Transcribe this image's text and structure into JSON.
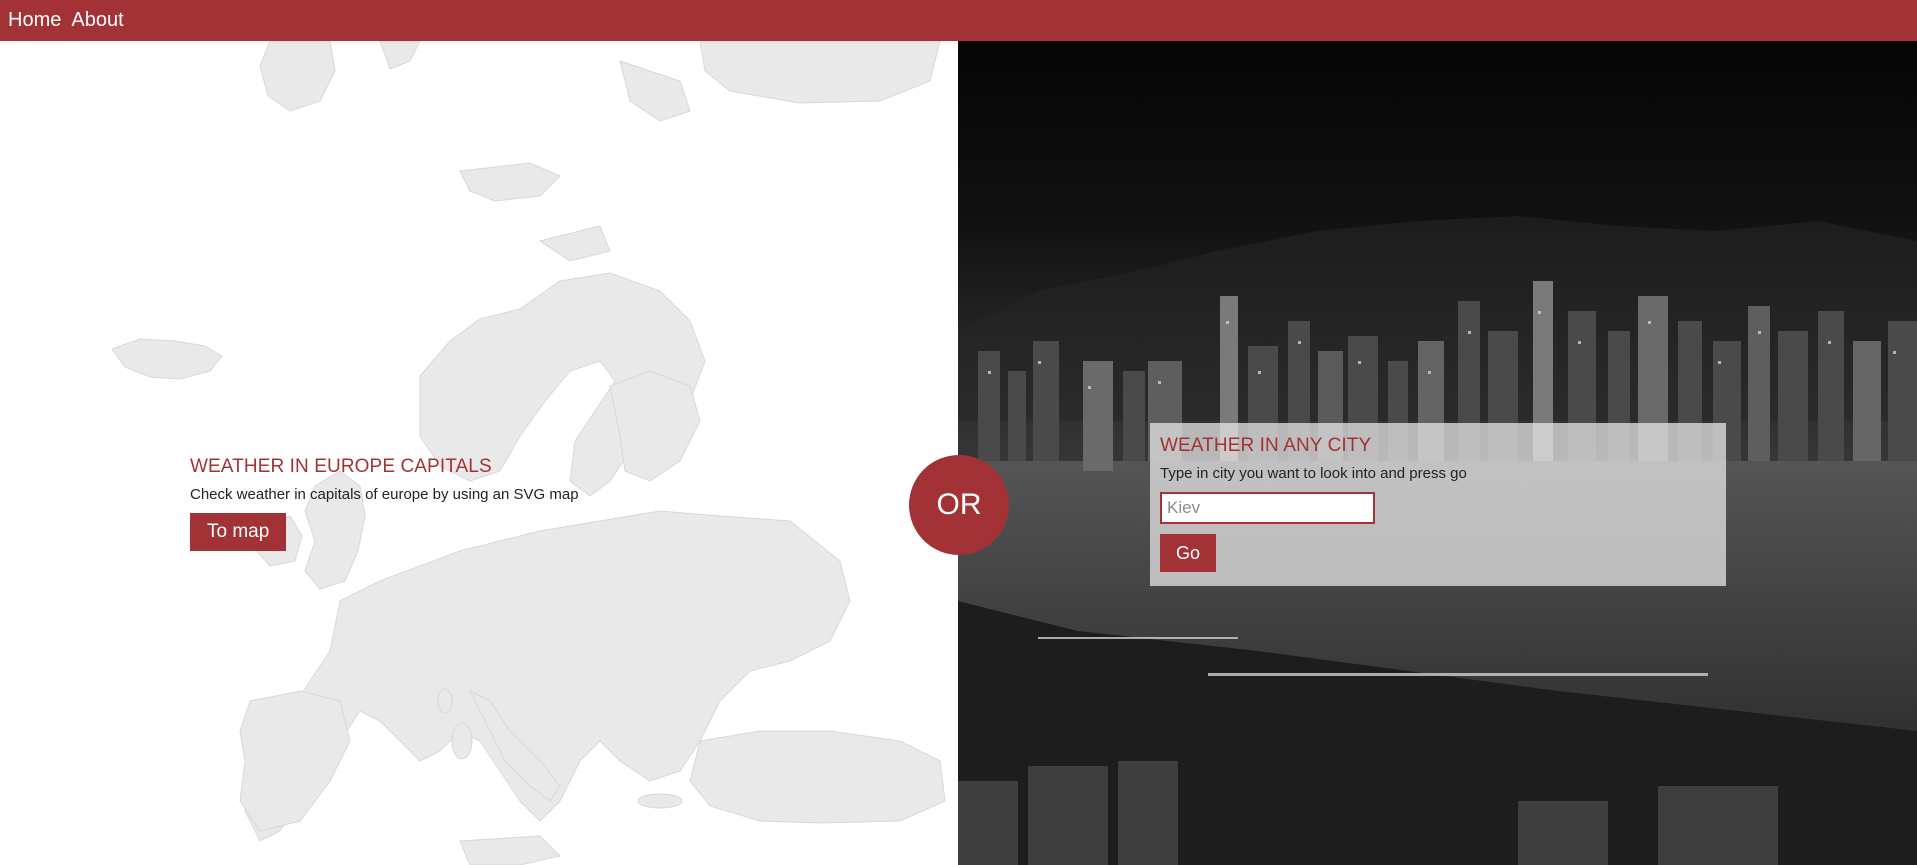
{
  "nav": {
    "home": "Home",
    "about": "About"
  },
  "map_section": {
    "title": "WEATHER IN EUROPE CAPITALS",
    "description": "Check weather in capitals of europe by using an SVG map",
    "button": "To map"
  },
  "divider": {
    "label": "OR"
  },
  "city_section": {
    "title": "WEATHER IN ANY CITY",
    "description": "Type in city you want to look into and press go",
    "input_placeholder": "Kiev",
    "input_value": "",
    "button": "Go"
  },
  "colors": {
    "accent": "#a33236",
    "map_land": "#e9e9e9"
  }
}
